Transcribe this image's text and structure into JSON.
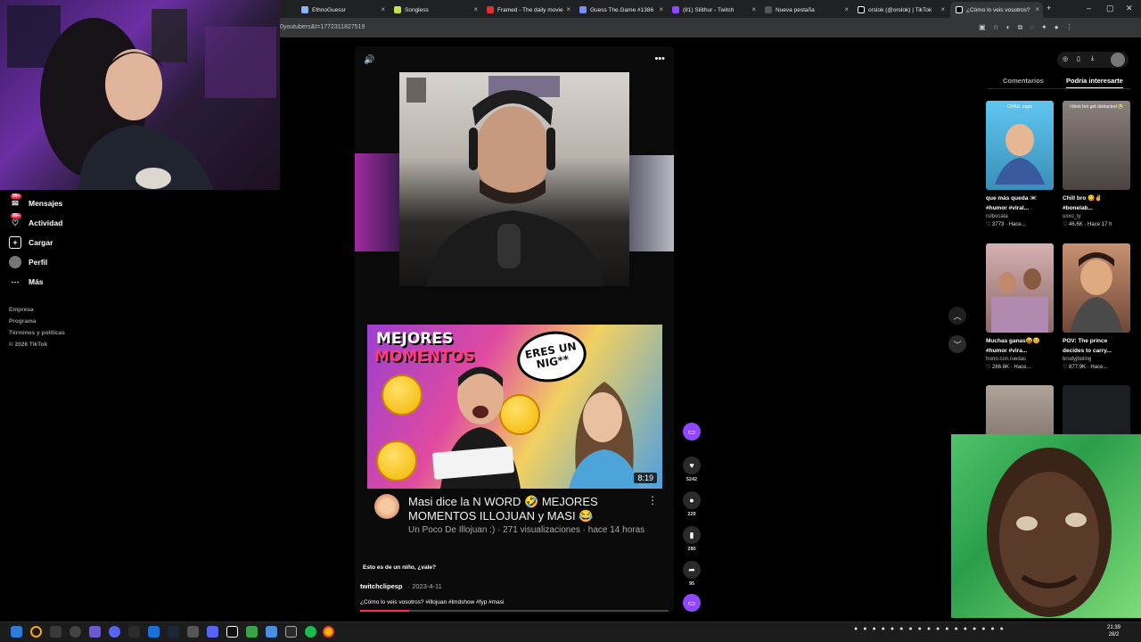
{
  "browser": {
    "tabs": [
      {
        "label": "EthnoGuessr",
        "color": "#8ab4f8"
      },
      {
        "label": "Songless",
        "color": "#c7e34a"
      },
      {
        "label": "Framed - The daily movie",
        "color": "#e03030"
      },
      {
        "label": "Guess The.Game #1386",
        "color": "#7b8cff"
      },
      {
        "label": "(81) Silithur - Twitch",
        "color": "#9146ff"
      },
      {
        "label": "Nueva pestaña",
        "color": "#999999"
      },
      {
        "label": "orslok (@orslok) | TikTok",
        "color": "#ffffff"
      },
      {
        "label": "¿Cómo lo veis vosotros?",
        "color": "#ffffff"
      }
    ],
    "url": "0youtubers&t=1772311827519"
  },
  "nav": {
    "items": [
      {
        "label": "Mensajes",
        "badge": "99+"
      },
      {
        "label": "Actividad",
        "badge": "99+"
      },
      {
        "label": "Cargar"
      },
      {
        "label": "Perfil"
      },
      {
        "label": "Más"
      }
    ],
    "footer": [
      "Empresa",
      "Programa",
      "Términos y políticas",
      "© 2026 TikTok"
    ]
  },
  "video": {
    "thumb_heading_1": "MEJORES",
    "thumb_heading_2": "MOMENTOS",
    "thumb_bubble": "ERES UN NIG**",
    "duration": "8:19",
    "yt_title": "Masi dice la N WORD 🤣 MEJORES MOMENTOS ILLOJUAN y MASI 😂",
    "yt_meta": "Un Poco De Illojuan :) · 271 visualizaciones · hace 14 horas",
    "caption": "Esto es de un niño, ¿vale?",
    "author": "twitchclipesp",
    "date": "2023-4-11",
    "description": "¿Cómo lo veis vosotros? #illojuan #lmdshow #fyp #masi",
    "progress": 0.16
  },
  "actions": {
    "likes": "5242",
    "comments": "229",
    "saves": "280",
    "shares": "95"
  },
  "right_panel": {
    "tabs": [
      "Comentarios",
      "Podría interesarte"
    ],
    "cards": [
      {
        "title": "que más queda 📼 #humor #viral...",
        "user": "rulbocata",
        "stats": "♡ 3773 · Hace...",
        "thumb_text": "CHAU, capo",
        "thumb_color": "#4fb3d9"
      },
      {
        "title": "Chill bro 😋✌ #bonelab...",
        "user": "uxxo_ty",
        "stats": "♡ 46.6K · Hace 17 h",
        "thumb_text": "i think bro got distracted 😭",
        "thumb_color": "#7d7470"
      },
      {
        "title": "Muchas ganas😝😊 #humor #vira...",
        "user": "trono.con.ruedas",
        "stats": "♡ 286.6K · Hace...",
        "thumb_text": "",
        "thumb_color": "#c99ea0"
      },
      {
        "title": "POV: The prince decides to carry...",
        "user": "brodyjboling",
        "stats": "♡ 877.9K · Hace...",
        "thumb_text": "",
        "thumb_color": "#b3806a"
      },
      {
        "title": "",
        "user": "",
        "stats": "",
        "thumb_text": "",
        "thumb_color": "#9a8e86"
      },
      {
        "title": "",
        "user": "",
        "stats": "",
        "thumb_text": "",
        "thumb_color": "#1c1f22"
      }
    ]
  },
  "taskbar": {
    "time": "21:39",
    "date": "28/2"
  }
}
